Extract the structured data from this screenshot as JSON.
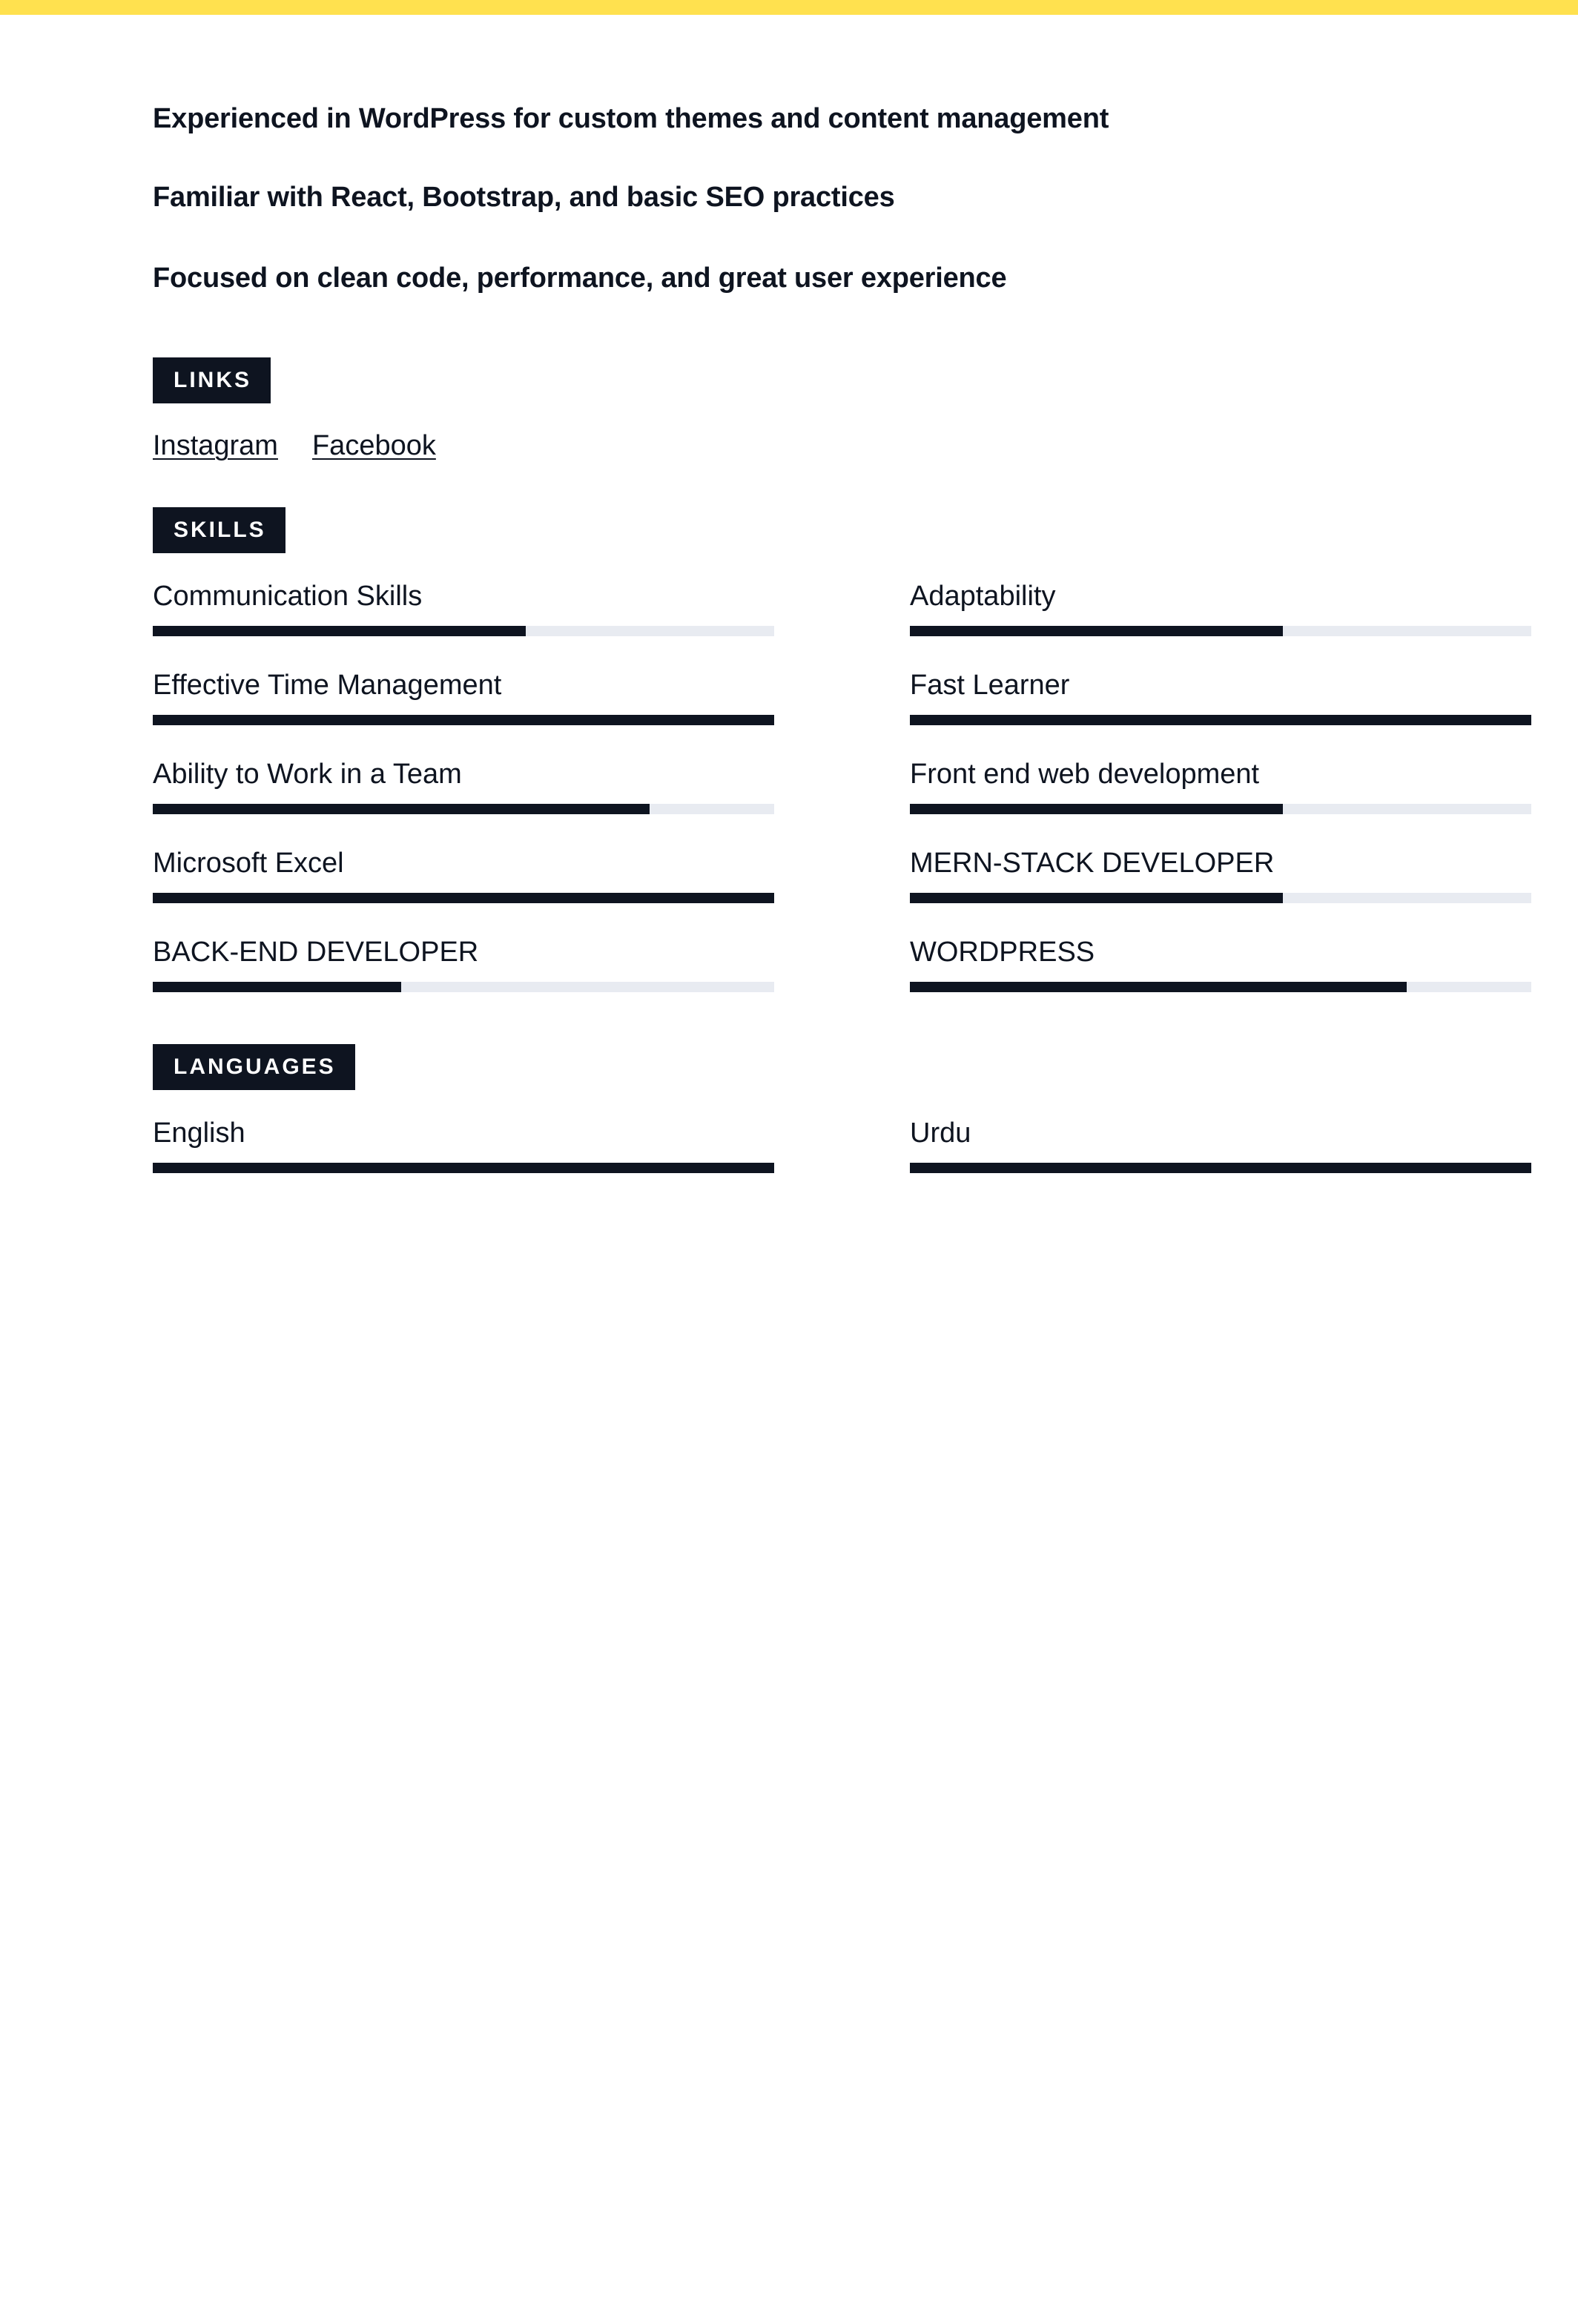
{
  "colors": {
    "accent_bar": "#ffe14f",
    "dark": "#0e1420",
    "track": "#e8ebf1"
  },
  "summary_bullets": [
    "Experienced in WordPress for custom themes and content management",
    "Familiar with React, Bootstrap, and basic SEO practices",
    "Focused on clean code, performance, and great user experience"
  ],
  "links": {
    "heading": "LINKS",
    "items": [
      {
        "label": "Instagram"
      },
      {
        "label": "Facebook"
      }
    ]
  },
  "skills": {
    "heading": "SKILLS",
    "items": [
      {
        "label": "Communication Skills",
        "level": 0.6
      },
      {
        "label": "Adaptability",
        "level": 0.6
      },
      {
        "label": "Effective Time Management",
        "level": 1.0
      },
      {
        "label": "Fast Learner",
        "level": 1.0
      },
      {
        "label": "Ability to Work in a Team",
        "level": 0.8
      },
      {
        "label": "Front end web development",
        "level": 0.6
      },
      {
        "label": "Microsoft Excel",
        "level": 1.0
      },
      {
        "label": "MERN-STACK DEVELOPER",
        "level": 0.6
      },
      {
        "label": "BACK-END DEVELOPER",
        "level": 0.4
      },
      {
        "label": "WORDPRESS",
        "level": 0.8
      }
    ]
  },
  "languages": {
    "heading": "LANGUAGES",
    "items": [
      {
        "label": "English",
        "level": 1.0
      },
      {
        "label": "Urdu",
        "level": 1.0
      }
    ]
  }
}
